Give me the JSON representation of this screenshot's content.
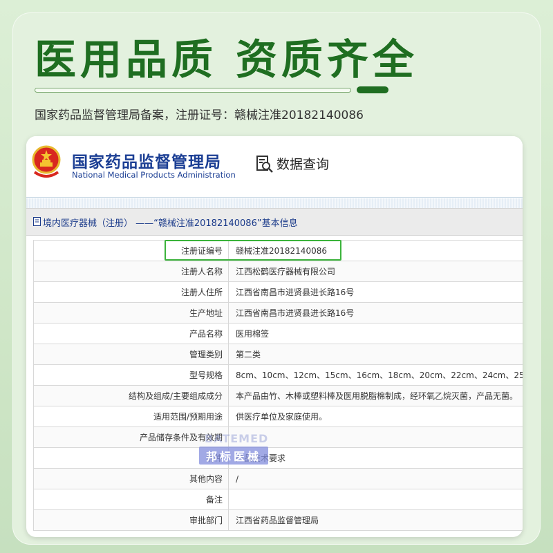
{
  "banner": {
    "headline": "医用品质 资质齐全",
    "registration_line": "国家药品监督管理局备案，注册证号：赣械注准20182140086"
  },
  "site": {
    "agency_name_cn": "国家药品监督管理局",
    "agency_name_en": "National Medical Products Administration",
    "query_label": "数据查询",
    "breadcrumb": "境内医疗器械（注册） ——“赣械注准20182140086”基本信息"
  },
  "record": {
    "rows": [
      {
        "label": "注册证编号",
        "value": "赣械注准20182140086"
      },
      {
        "label": "注册人名称",
        "value": "江西松鹤医疗器械有限公司"
      },
      {
        "label": "注册人住所",
        "value": "江西省南昌市进贤县进长路16号"
      },
      {
        "label": "生产地址",
        "value": "江西省南昌市进贤县进长路16号"
      },
      {
        "label": "产品名称",
        "value": "医用棉签"
      },
      {
        "label": "管理类别",
        "value": "第二类"
      },
      {
        "label": "型号规格",
        "value": "8cm、10cm、12cm、15cm、16cm、18cm、20cm、22cm、24cm、25c"
      },
      {
        "label": "结构及组成/主要组成成分",
        "value": "本产品由竹、木棒或塑料棒及医用脱脂棉制成，经环氧乙烷灭菌，产品无菌。"
      },
      {
        "label": "适用范围/预期用途",
        "value": "供医疗单位及家庭使用。"
      },
      {
        "label": "产品储存条件及有效期",
        "value": ""
      },
      {
        "label": "附件",
        "value": "产品技术要求"
      },
      {
        "label": "其他内容",
        "value": "/"
      },
      {
        "label": "备注",
        "value": ""
      },
      {
        "label": "审批部门",
        "value": "江西省药品监督管理局"
      }
    ]
  },
  "watermark": {
    "en": "BATEMED",
    "cn": "邦标医械"
  },
  "colors": {
    "headline_green": "#1f6e21",
    "agency_blue": "#1c3f94",
    "highlight_green": "#3bb33b"
  },
  "icons": [
    "national-emblem-icon",
    "data-query-icon",
    "document-icon"
  ]
}
